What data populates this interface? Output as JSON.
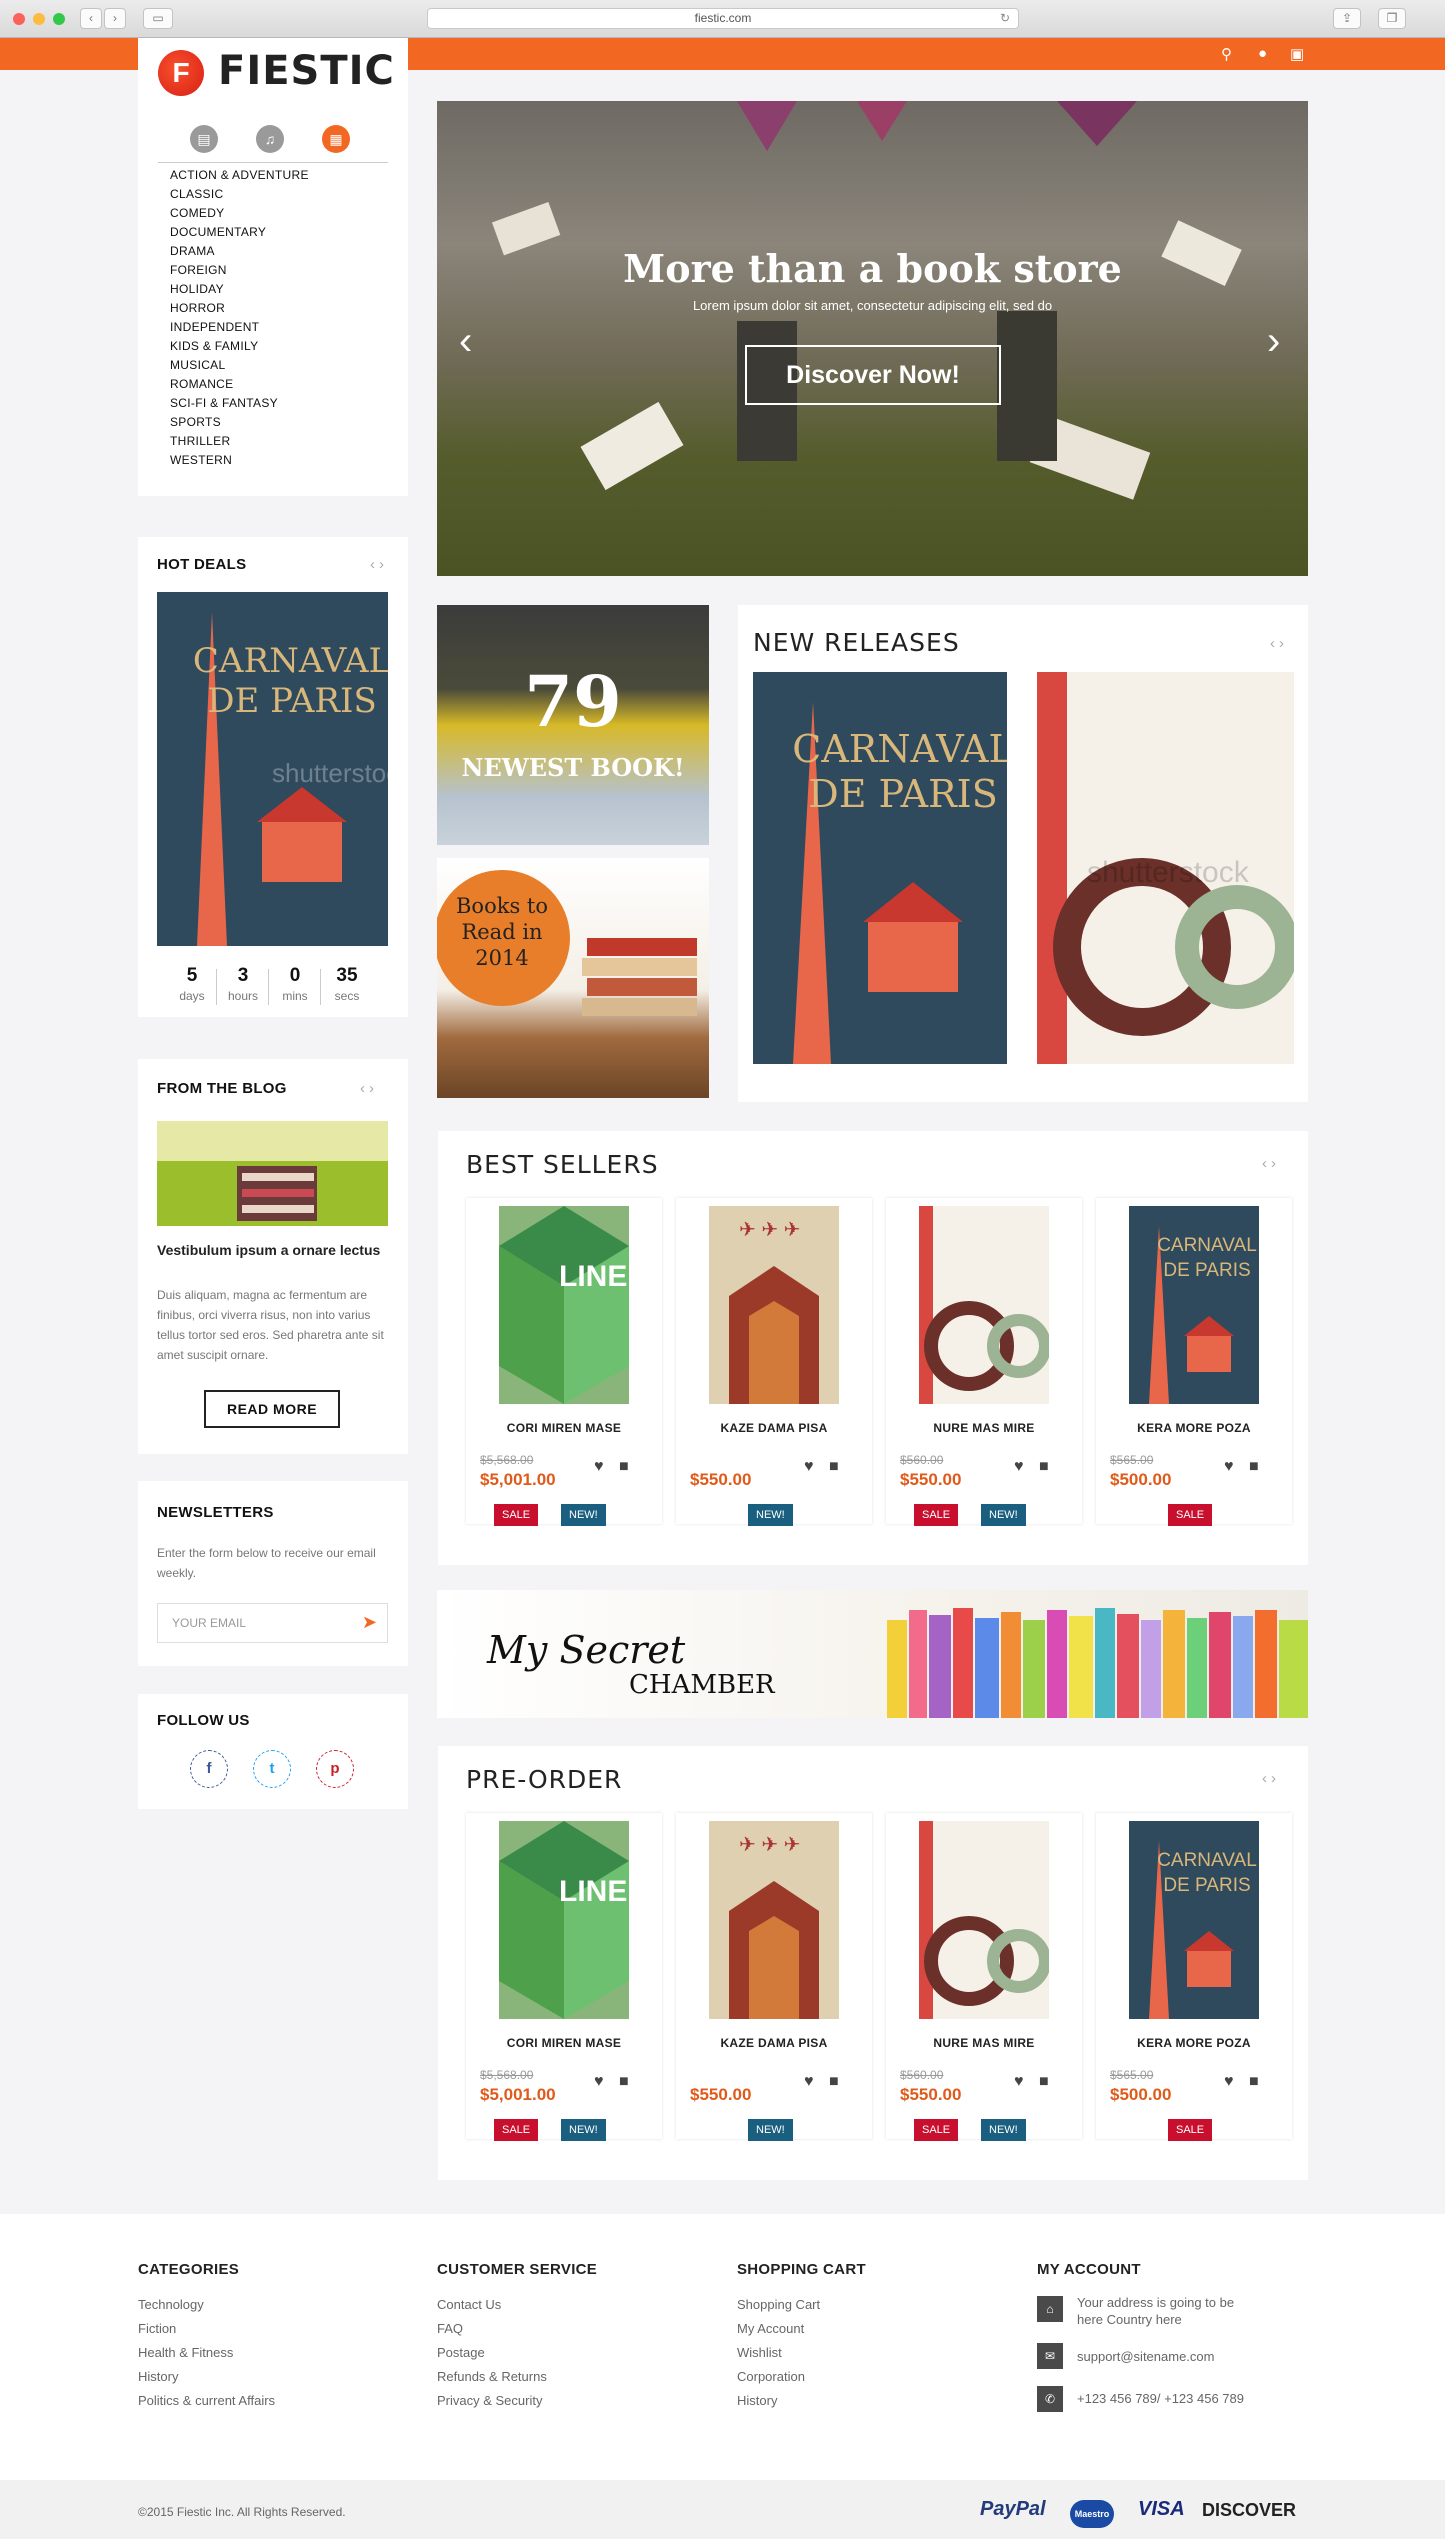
{
  "browser": {
    "url": "fiestic.com"
  },
  "brand": {
    "name": "FIESTIC",
    "logo_letter": "F",
    "accent": "#f26722"
  },
  "sidebar": {
    "categories": [
      "ACTION & ADVENTURE",
      "CLASSIC",
      "COMEDY",
      "DOCUMENTARY",
      "DRAMA",
      "FOREIGN",
      "HOLIDAY",
      "HORROR",
      "INDEPENDENT",
      "KIDS & FAMILY",
      "MUSICAL",
      "ROMANCE",
      "SCI-FI & FANTASY",
      "SPORTS",
      "THRILLER",
      "WESTERN"
    ],
    "hot_deals": {
      "title": "HOT DEALS",
      "countdown": [
        {
          "value": "5",
          "unit": "days"
        },
        {
          "value": "3",
          "unit": "hours"
        },
        {
          "value": "0",
          "unit": "mins"
        },
        {
          "value": "35",
          "unit": "secs"
        }
      ]
    },
    "blog": {
      "title": "FROM THE BLOG",
      "post_title": "Vestibulum ipsum a ornare lectus",
      "post_text": "Duis aliquam, magna ac fermentum are finibus, orci viverra risus, non into varius tellus tortor sed eros. Sed pharetra ante sit amet suscipit ornare.",
      "button": "READ MORE"
    },
    "newsletter": {
      "title": "NEWSLETTERS",
      "text": "Enter the form below to receive our email weekly.",
      "placeholder": "YOUR EMAIL"
    },
    "follow": {
      "title": "FOLLOW US"
    }
  },
  "hero": {
    "title": "More than a book store",
    "subtitle": "Lorem ipsum dolor sit amet, consectetur adipiscing elit, sed do",
    "button": "Discover Now!"
  },
  "promos": {
    "p1_number": "79",
    "p1_text": "NEWEST BOOK!",
    "p2_text": "Books to Read in 2014"
  },
  "new_releases": {
    "title": "NEW RELEASES"
  },
  "banner": {
    "script": "My Secret",
    "caps": "CHAMBER"
  },
  "best_sellers": {
    "title": "BEST SELLERS",
    "items": [
      {
        "name": "CORI MIREN MASE",
        "old": "$5,568.00",
        "price": "$5,001.00",
        "tags": [
          "SALE",
          "NEW!"
        ]
      },
      {
        "name": "KAZE DAMA PISA",
        "old": "",
        "price": "$550.00",
        "tags": [
          "NEW!"
        ]
      },
      {
        "name": "NURE MAS MIRE",
        "old": "$560.00",
        "price": "$550.00",
        "tags": [
          "SALE",
          "NEW!"
        ]
      },
      {
        "name": "KERA MORE POZA",
        "old": "$565.00",
        "price": "$500.00",
        "tags": [
          "SALE"
        ]
      }
    ]
  },
  "pre_order": {
    "title": "PRE-ORDER",
    "items": [
      {
        "name": "CORI MIREN MASE",
        "old": "$5,568.00",
        "price": "$5,001.00",
        "tags": [
          "SALE",
          "NEW!"
        ]
      },
      {
        "name": "KAZE DAMA PISA",
        "old": "",
        "price": "$550.00",
        "tags": [
          "NEW!"
        ]
      },
      {
        "name": "NURE MAS MIRE",
        "old": "$560.00",
        "price": "$550.00",
        "tags": [
          "SALE",
          "NEW!"
        ]
      },
      {
        "name": "KERA MORE POZA",
        "old": "$565.00",
        "price": "$500.00",
        "tags": [
          "SALE"
        ]
      }
    ]
  },
  "footer": {
    "categories": {
      "title": "CATEGORIES",
      "links": [
        "Technology",
        "Fiction",
        "Health & Fitness",
        "History",
        "Politics & current Affairs"
      ]
    },
    "service": {
      "title": "CUSTOMER SERVICE",
      "links": [
        "Contact Us",
        "FAQ",
        "Postage",
        "Refunds & Returns",
        "Privacy & Security"
      ]
    },
    "cart": {
      "title": "SHOPPING CART",
      "links": [
        "Shopping Cart",
        "My Account",
        "Wishlist",
        "Corporation",
        "History"
      ]
    },
    "account": {
      "title": "MY ACCOUNT",
      "address": "Your address is going to be here Country here",
      "email": "support@sitename.com",
      "phone": "+123 456 789/ +123 456 789"
    },
    "copyright": "©2015 Fiestic Inc. All Rights Reserved.",
    "payments": [
      "PayPal",
      "Maestro",
      "VISA",
      "DISCOVER"
    ]
  }
}
